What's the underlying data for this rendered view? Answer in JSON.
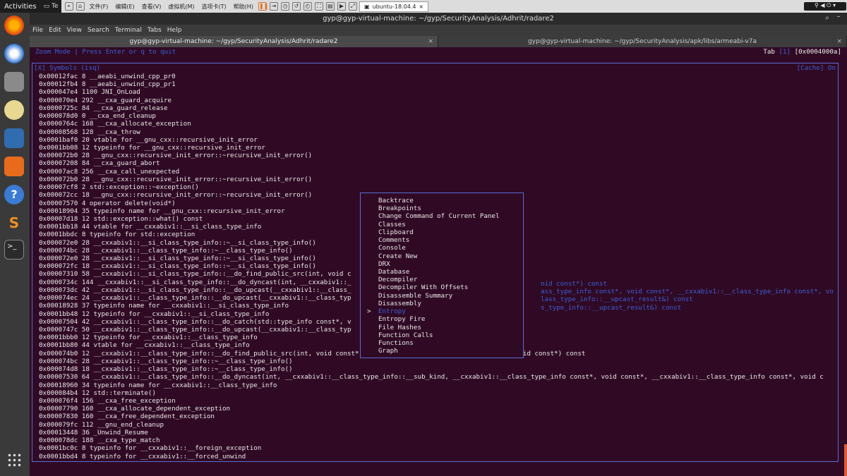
{
  "system": {
    "activities": "Activities",
    "te_tab": "Te"
  },
  "vm": {
    "menus": [
      "文件(F)",
      "编辑(E)",
      "查看(V)",
      "虚拟机(M)",
      "选项卡(T)",
      "帮助(H)"
    ],
    "tab": "ubuntu-18.04.4"
  },
  "terminal": {
    "title": "gyp@gyp-virtual-machine: ~/gyp/SecurityAnalysis/Adhrit/radare2",
    "menus": [
      "File",
      "Edit",
      "View",
      "Search",
      "Terminal",
      "Tabs",
      "Help"
    ],
    "tabs": [
      {
        "label": "gyp@gyp-virtual-machine: ~/gyp/SecurityAnalysis/Adhrit/radare2"
      },
      {
        "label": "gyp@gyp-virtual-machine: ~/gyp/SecurityAnalysis/apk/libs/armeabi-v7a"
      }
    ]
  },
  "r2": {
    "zoom_hint": "Zoom Mode | Press Enter or q to quit",
    "tab_label": "Tab ",
    "tab_num": "[1]",
    "address": " [0x0004000a]",
    "panel_title": "[X] Symbols (isq)",
    "cache": "[Cache] On",
    "symbols": [
      "0x00012fac 8 __aeabi_unwind_cpp_pr0",
      "0x00012fb4 8 __aeabi_unwind_cpp_pr1",
      "0x000047e4 1100 JNI_OnLoad",
      "0x000070e4 292 __cxa_guard_acquire",
      "0x0000725c 84 __cxa_guard_release",
      "0x000078d0 0 __cxa_end_cleanup",
      "0x0000764c 168 __cxa_allocate_exception",
      "0x00008568 128 __cxa_throw",
      "0x0001baf0 20 vtable for __gnu_cxx::recursive_init_error",
      "0x0001bb08 12 typeinfo for __gnu_cxx::recursive_init_error",
      "0x000072b0 28 __gnu_cxx::recursive_init_error::~recursive_init_error()",
      "0x00007208 84 __cxa_guard_abort",
      "0x00007ac8 256 __cxa_call_unexpected",
      "0x000072b0 28 __gnu_cxx::recursive_init_error::~recursive_init_error()",
      "0x00007cf8 2 std::exception::~exception()",
      "0x000072cc 18 __gnu_cxx::recursive_init_error::~recursive_init_error()",
      "0x00007570 4 operator delete(void*)",
      "0x00018904 35 typeinfo name for __gnu_cxx::recursive_init_error",
      "0x00007d18 12 std::exception::what() const",
      "0x0001bb18 44 vtable for __cxxabiv1::__si_class_type_info",
      "0x0001bbdc 8 typeinfo for std::exception",
      "0x000072e0 28 __cxxabiv1::__si_class_type_info::~__si_class_type_info()",
      "0x000074bc 28 __cxxabiv1::__class_type_info::~__class_type_info()",
      "0x000072e0 28 __cxxabiv1::__si_class_type_info::~__si_class_type_info()",
      "0x000072fc 18 __cxxabiv1::__si_class_type_info::~__si_class_type_info()",
      "0x00007310 58 __cxxabiv1::__si_class_type_info::__do_find_public_src(int, void c",
      "0x0000734c 144 __cxxabiv1::__si_class_type_info::__do_dyncast(int, __cxxabiv1::_",
      "0x000073dc 42 __cxxabiv1::__si_class_type_info::__do_upcast(__cxxabiv1::__class_",
      "0x000074ec 24 __cxxabiv1::__class_type_info::__do_upcast(__cxxabiv1::__class_typ",
      "0x00018928 37 typeinfo name for __cxxabiv1::__si_class_type_info",
      "0x0001bb48 12 typeinfo for __cxxabiv1::__si_class_type_info",
      "0x00007504 42 __cxxabiv1::__class_type_info::__do_catch(std::type_info const*, v",
      "0x0000747c 50 __cxxabiv1::__class_type_info::__do_upcast(__cxxabiv1::__class_typ",
      "0x0001bbb0 12 typeinfo for __cxxabiv1::__class_type_info",
      "0x0001bb80 44 vtable for __cxxabiv1::__class_type_info",
      "0x000074b0 12 __cxxabiv1::__class_type_info::__do_find_public_src(int, void const*, __cxxabiv1::__class_type_info const*, void const*) const",
      "0x000074bc 28 __cxxabiv1::__class_type_info::~__class_type_info()",
      "0x000074d8 18 __cxxabiv1::__class_type_info::~__class_type_info()",
      "0x00007530 64 __cxxabiv1::__class_type_info::__do_dyncast(int, __cxxabiv1::__class_type_info::__sub_kind, __cxxabiv1::__class_type_info const*, void const*, __cxxabiv1::__class_type_info const*, void c",
      "0x00018960 34 typeinfo name for __cxxabiv1::__class_type_info",
      "0x000084b4 12 std::terminate()",
      "0x000076f4 156 __cxa_free_exception",
      "0x00007790 160 __cxa_allocate_dependent_exception",
      "0x00007830 160 __cxa_free_dependent_exception",
      "0x000079fc 112 __gnu_end_cleanup",
      "0x00013448 36 _Unwind_Resume",
      "0x000078dc 188 __cxa_type_match",
      "0x0001bc0c 8 typeinfo for __cxxabiv1::__foreign_exception",
      "0x0001bbd4 8 typeinfo for __cxxabiv1::__forced_unwind"
    ],
    "menu_items": [
      "Backtrace",
      "Breakpoints",
      "Change Command of Current Panel",
      "Classes",
      "Clipboard",
      "Comments",
      "Console",
      "Create New",
      "DRX",
      "Database",
      "Decompiler",
      "Decompiler With Offsets",
      "Disassemble Summary",
      "Disassembly",
      "Entropy",
      "Entropy Fire",
      "File Hashes",
      "Function Calls",
      "Functions",
      "Graph"
    ],
    "selected_item": "Entropy",
    "arrow": ">",
    "overflow_blue": [
      "oid const*) const",
      "ass_type_info const*, void const*, __cxxabiv1::__class_type_info const*, vo",
      "lass_type_info::__upcast_result&) const",
      "s_type_info::__upcast_result&) const"
    ]
  }
}
